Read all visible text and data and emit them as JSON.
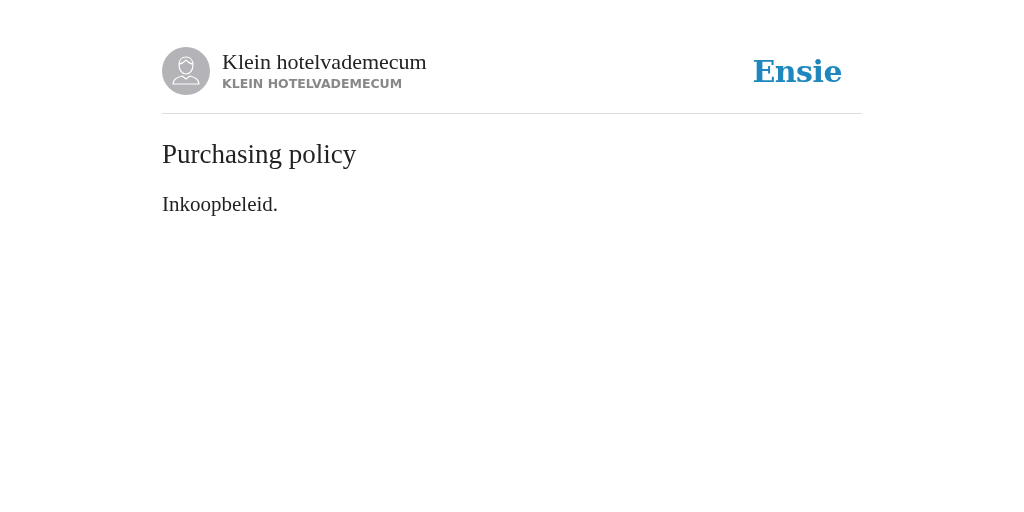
{
  "header": {
    "title": "Klein hotelvademecum",
    "subtitle": "KLEIN HOTELVADEMECUM",
    "logo": "Ensie"
  },
  "article": {
    "heading": "Purchasing policy",
    "body": "Inkoopbeleid."
  }
}
